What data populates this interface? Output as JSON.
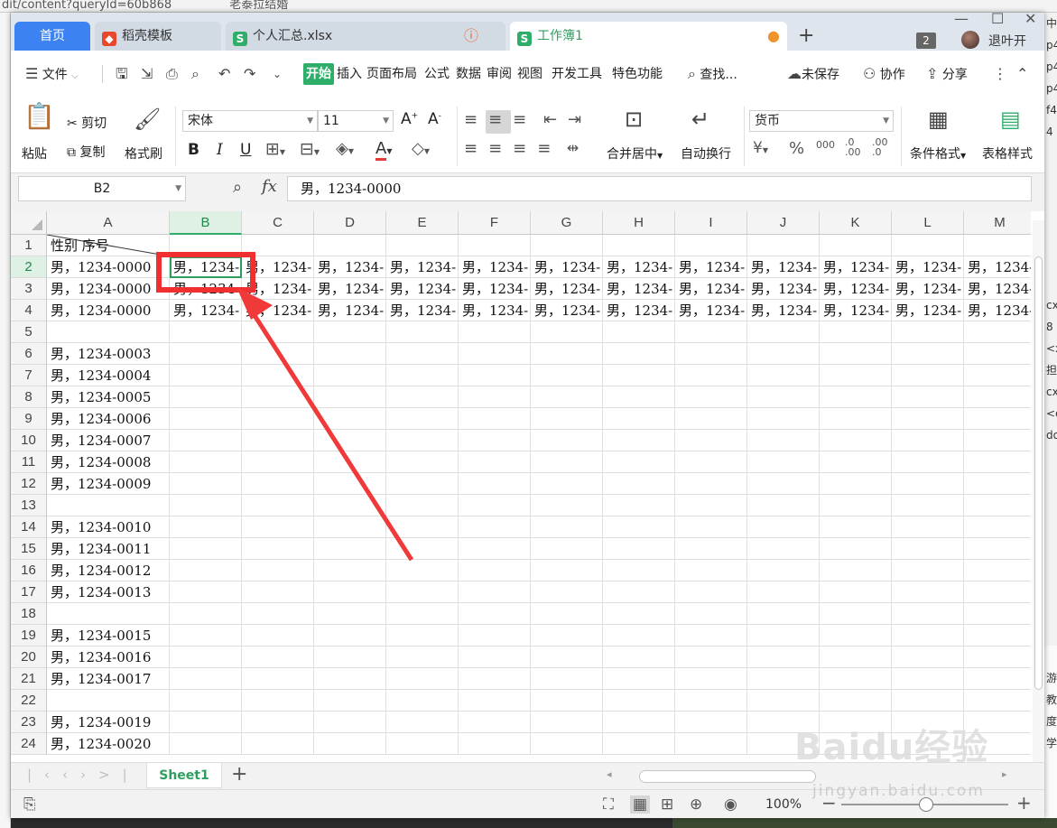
{
  "browser_url": "dit/content?queryId=60b868",
  "browser_tab": "老泰拉结婚",
  "tabs": [
    {
      "label": "首页"
    },
    {
      "label": "稻壳模板"
    },
    {
      "label": "个人汇总.xlsx"
    },
    {
      "label": "工作簿1"
    }
  ],
  "window": {
    "notif_count": "2",
    "user": "退叶开"
  },
  "menu": {
    "file": "文件",
    "items": [
      "开始",
      "插入",
      "页面布局",
      "公式",
      "数据",
      "审阅",
      "视图",
      "开发工具",
      "特色功能"
    ],
    "search": "查找...",
    "unsaved": "未保存",
    "collab": "协作",
    "share": "分享"
  },
  "ribbon": {
    "paste": "粘贴",
    "cut": "剪切",
    "copy": "复制",
    "format_painter": "格式刷",
    "font": "宋体",
    "size": "11",
    "merge": "合并居中",
    "wrap": "自动换行",
    "number_format": "货币",
    "cond_format": "条件格式",
    "table_style": "表格样式"
  },
  "formula": {
    "name_box": "B2",
    "fx": "fx",
    "value": "男，1234-0000"
  },
  "columns": [
    "A",
    "B",
    "C",
    "D",
    "E",
    "F",
    "G",
    "H",
    "I",
    "J",
    "K",
    "L",
    "M"
  ],
  "rows": [
    {
      "n": "1",
      "a": "性别       序号",
      "rest": false
    },
    {
      "n": "2",
      "a": "男，1234-0000",
      "rest": true
    },
    {
      "n": "3",
      "a": "男，1234-0000",
      "rest": true
    },
    {
      "n": "4",
      "a": "男，1234-0000",
      "rest": true
    },
    {
      "n": "5",
      "a": "",
      "rest": false
    },
    {
      "n": "6",
      "a": "男，1234-0003",
      "rest": false
    },
    {
      "n": "7",
      "a": "男，1234-0004",
      "rest": false
    },
    {
      "n": "8",
      "a": "男，1234-0005",
      "rest": false
    },
    {
      "n": "9",
      "a": "男，1234-0006",
      "rest": false
    },
    {
      "n": "10",
      "a": "男，1234-0007",
      "rest": false
    },
    {
      "n": "11",
      "a": "男，1234-0008",
      "rest": false
    },
    {
      "n": "12",
      "a": "男，1234-0009",
      "rest": false
    },
    {
      "n": "13",
      "a": "",
      "rest": false
    },
    {
      "n": "14",
      "a": "男，1234-0010",
      "rest": false
    },
    {
      "n": "15",
      "a": "男，1234-0011",
      "rest": false
    },
    {
      "n": "16",
      "a": "男，1234-0012",
      "rest": false
    },
    {
      "n": "17",
      "a": "男，1234-0013",
      "rest": false
    },
    {
      "n": "18",
      "a": "",
      "rest": false
    },
    {
      "n": "19",
      "a": "男，1234-0015",
      "rest": false
    },
    {
      "n": "20",
      "a": "男，1234-0016",
      "rest": false
    },
    {
      "n": "21",
      "a": "男，1234-0017",
      "rest": false
    },
    {
      "n": "22",
      "a": "",
      "rest": false
    },
    {
      "n": "23",
      "a": "男，1234-0019",
      "rest": false
    },
    {
      "n": "24",
      "a": "男，1234-0020",
      "rest": false
    }
  ],
  "truncated_cell": "男，1234-",
  "sheet": {
    "name": "Sheet1"
  },
  "status": {
    "zoom": "100%"
  },
  "watermark": {
    "main": "Baidu经验",
    "sub": "jingyan.baidu.com"
  },
  "right_edge_chars": [
    "中",
    "p4",
    "p4",
    "p4",
    "f4",
    "4",
    "",
    "",
    "",
    "",
    "",
    "",
    "",
    "cx",
    "8",
    "<x",
    "担",
    "cx",
    "<e",
    "do"
  ],
  "right_edge_lower": [
    "",
    "游",
    "教",
    "度",
    "学"
  ],
  "colors": {
    "accent_green": "#2fae6a",
    "home_tab": "#3d82f2",
    "highlight": "#f03030"
  }
}
